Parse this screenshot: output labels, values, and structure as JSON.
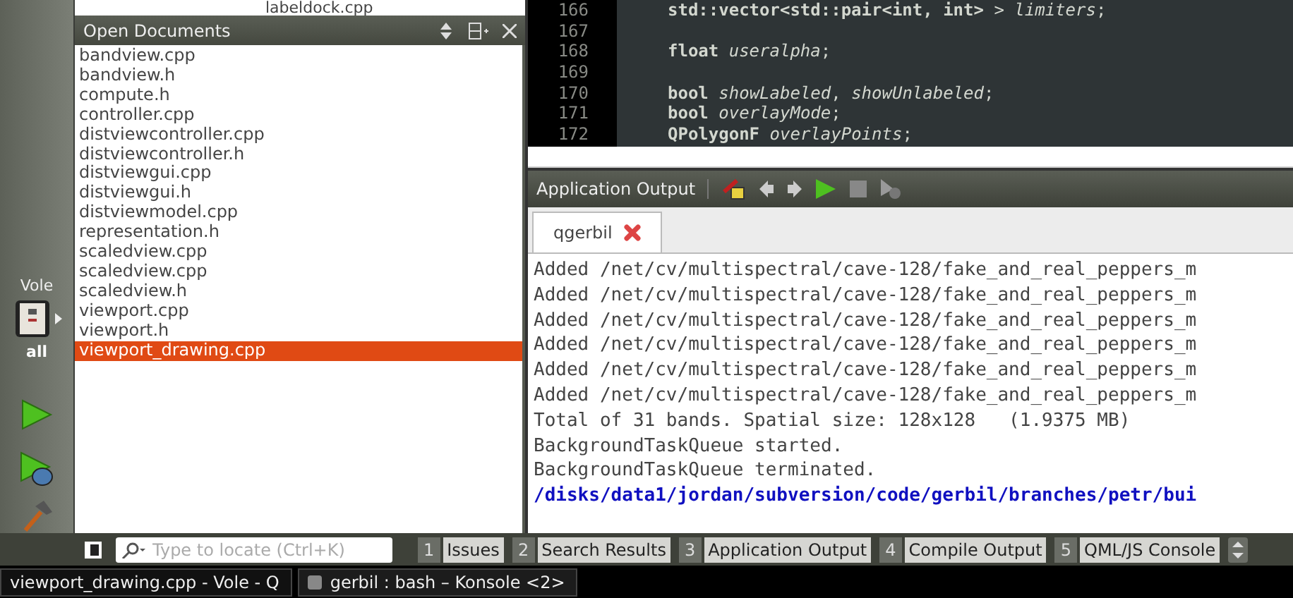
{
  "mode_bar": {
    "project": "Vole",
    "target": "all"
  },
  "file_combo": {
    "value": "labeldock.cpp"
  },
  "open_documents": {
    "title": "Open Documents",
    "items": [
      {
        "label": "bandview.cpp",
        "selected": false
      },
      {
        "label": "bandview.h",
        "selected": false
      },
      {
        "label": "compute.h",
        "selected": false
      },
      {
        "label": "controller.cpp",
        "selected": false
      },
      {
        "label": "distviewcontroller.cpp",
        "selected": false
      },
      {
        "label": "distviewcontroller.h",
        "selected": false
      },
      {
        "label": "distviewgui.cpp",
        "selected": false
      },
      {
        "label": "distviewgui.h",
        "selected": false
      },
      {
        "label": "distviewmodel.cpp",
        "selected": false
      },
      {
        "label": "representation.h",
        "selected": false
      },
      {
        "label": "scaledview.cpp",
        "selected": false
      },
      {
        "label": "scaledview.cpp",
        "selected": false
      },
      {
        "label": "scaledview.h",
        "selected": false
      },
      {
        "label": "viewport.cpp",
        "selected": false
      },
      {
        "label": "viewport.h",
        "selected": false
      },
      {
        "label": "viewport_drawing.cpp",
        "selected": true
      }
    ]
  },
  "editor": {
    "lines": [
      {
        "number": "166",
        "code": "**std::vector<std::pair<int, int>** > *limiters*;"
      },
      {
        "number": "167"
      },
      {
        "number": "168",
        "code": "**float** *useralpha*;"
      },
      {
        "number": "169"
      },
      {
        "number": "170",
        "code": "**bool** *showLabeled*, *showUnlabeled*;"
      },
      {
        "number": "171",
        "code": "**bool** *overlayMode*;"
      },
      {
        "number": "172",
        "code": "**QPolygonF** *overlayPoints*;"
      }
    ]
  },
  "application_output": {
    "title": "Application Output",
    "tabs": [
      {
        "label": "qgerbil",
        "selected": true
      }
    ],
    "lines": [
      {
        "kind": "normal",
        "text": "Added /net/cv/multispectral/cave-128/fake_and_real_peppers_m"
      },
      {
        "kind": "normal",
        "text": "Added /net/cv/multispectral/cave-128/fake_and_real_peppers_m"
      },
      {
        "kind": "normal",
        "text": "Added /net/cv/multispectral/cave-128/fake_and_real_peppers_m"
      },
      {
        "kind": "normal",
        "text": "Added /net/cv/multispectral/cave-128/fake_and_real_peppers_m"
      },
      {
        "kind": "normal",
        "text": "Added /net/cv/multispectral/cave-128/fake_and_real_peppers_m"
      },
      {
        "kind": "normal",
        "text": "Added /net/cv/multispectral/cave-128/fake_and_real_peppers_m"
      },
      {
        "kind": "normal",
        "text": "Total of 31 bands. Spatial size: 128x128   (1.9375 MB)"
      },
      {
        "kind": "normal",
        "text": "BackgroundTaskQueue started."
      },
      {
        "kind": "normal",
        "text": "BackgroundTaskQueue terminated."
      },
      {
        "kind": "path",
        "text": "/disks/data1/jordan/subversion/code/gerbil/branches/petr/bui"
      }
    ]
  },
  "status_bar": {
    "locator": {
      "placeholder": "Type to locate (Ctrl+K)"
    },
    "panes": [
      {
        "number": "1",
        "label": "Issues"
      },
      {
        "number": "2",
        "label": "Search Results"
      },
      {
        "number": "3",
        "label": "Application Output"
      },
      {
        "number": "4",
        "label": "Compile Output"
      },
      {
        "number": "5",
        "label": "QML/JS Console"
      }
    ]
  },
  "taskbar": {
    "items": [
      {
        "label": "viewport_drawing.cpp - Vole - Q",
        "selected": true
      },
      {
        "label": "gerbil : bash – Konsole <2>",
        "selected": false
      }
    ]
  }
}
